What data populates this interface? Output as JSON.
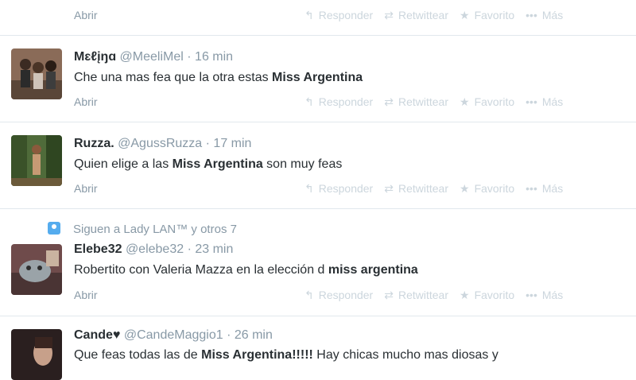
{
  "action_labels": {
    "open": "Abrir",
    "reply": "Responder",
    "retweet": "Retwittear",
    "favorite": "Favorito",
    "more": "Más"
  },
  "action_icons": {
    "reply": "reply-arrow-icon",
    "retweet": "retweet-icon",
    "favorite": "star-icon",
    "more": "more-dots-icon"
  },
  "context_row": {
    "icon": "follow-user-icon",
    "text": "Siguen a Lady LAN™ y otros 7"
  },
  "tweets": [
    {
      "name": "Mɛℓįŋɑ",
      "handle": "@MeeliMel",
      "sep": "·",
      "time": "16 min",
      "text_before": "Che una mas fea que la otra estas ",
      "text_bold": "Miss Argentina",
      "text_after": ""
    },
    {
      "name": "Ruzza.",
      "handle": "@AgussRuzza",
      "sep": "·",
      "time": "17 min",
      "text_before": "Quien elige a las ",
      "text_bold": "Miss Argentina",
      "text_after": " son muy feas"
    },
    {
      "name": "Elebe32",
      "handle": "@elebe32",
      "sep": "·",
      "time": "23 min",
      "text_before": "Robertito con Valeria Mazza en la elección d ",
      "text_bold": "miss argentina",
      "text_after": ""
    },
    {
      "name": "Cande♥",
      "handle": "@CandeMaggio1",
      "sep": "·",
      "time": "26 min",
      "text_before": "Que feas todas las de ",
      "text_bold": "Miss Argentina!!!!!",
      "text_after": " Hay chicas mucho mas diosas y"
    }
  ]
}
